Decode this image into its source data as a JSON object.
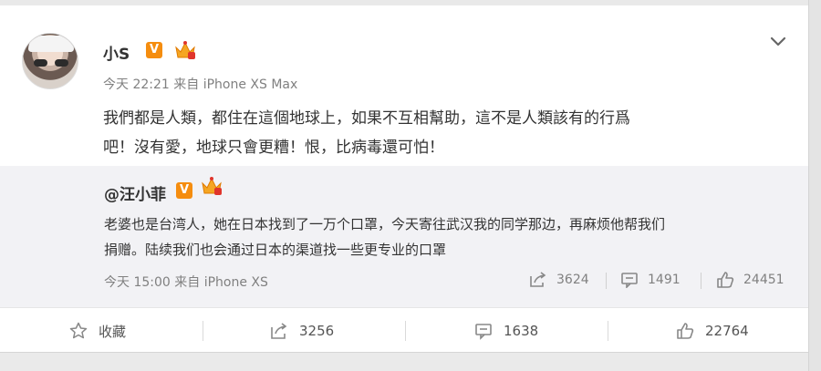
{
  "post": {
    "username": "小S",
    "verified_badge": "V",
    "meta": "今天 22:21 来自 iPhone XS Max",
    "text_line1": "我們都是人類，都住在這個地球上，如果不互相幫助，這不是人類該有的行爲",
    "text_line2": "吧！沒有愛，地球只會更糟！恨，比病毒還可怕！"
  },
  "repost": {
    "author": "@汪小菲",
    "verified_badge": "V",
    "text_line1": "老婆也是台湾人，她在日本找到了一万个口罩，今天寄往武汉我的同学那边，再麻烦他帮我们",
    "text_line2": "捐赠。陆续我们也会通过日本的渠道找一些更专业的口罩",
    "meta": "今天 15:00 来自 iPhone XS",
    "shares": "3624",
    "comments": "1491",
    "likes": "24451"
  },
  "actions": {
    "favorite_label": "收藏",
    "shares": "3256",
    "comments": "1638",
    "likes": "22764"
  },
  "colors": {
    "badge": "#f58d0f",
    "repost_bg": "#f2f2f5",
    "meta_text": "#808080"
  },
  "icons": [
    "avatar",
    "verified-badge",
    "member-crown-icon",
    "chevron-down-icon",
    "share-icon",
    "comment-icon",
    "like-icon",
    "star-icon"
  ]
}
